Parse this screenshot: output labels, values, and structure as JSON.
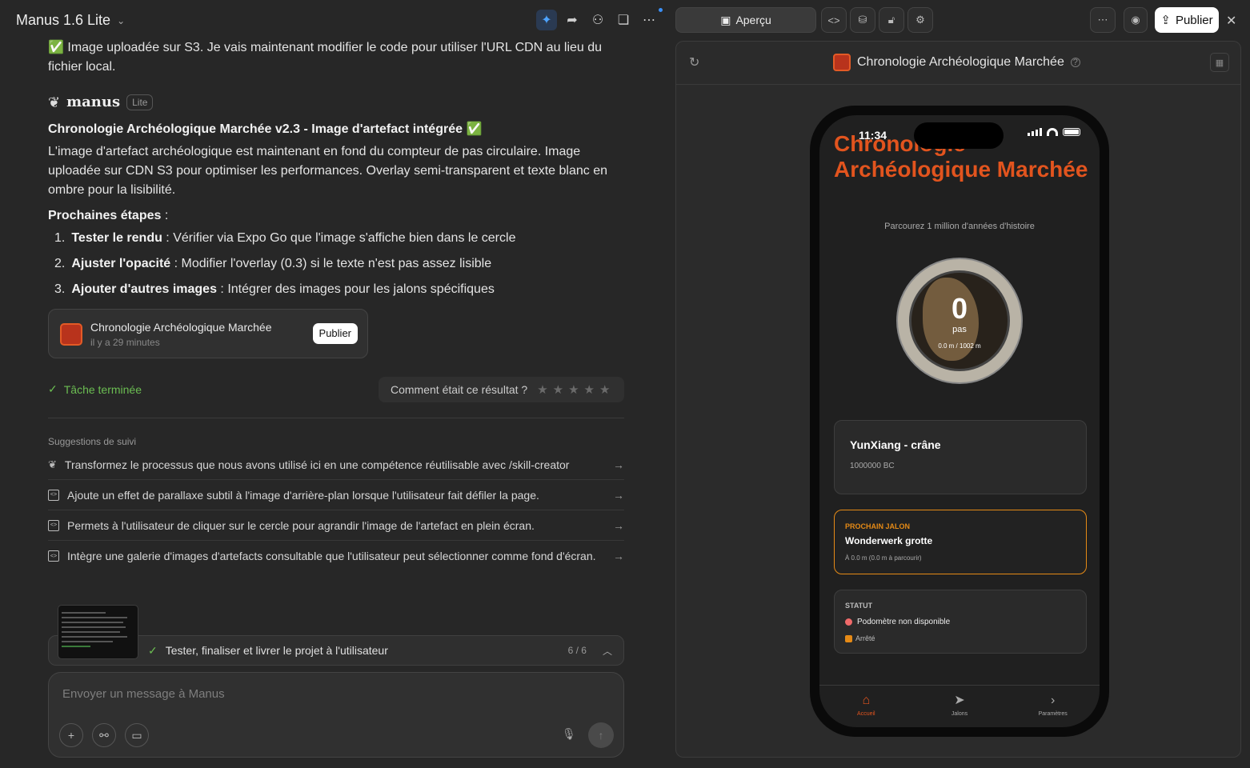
{
  "header": {
    "model": "Manus 1.6 Lite"
  },
  "chat": {
    "uploaded_msg": "✅ Image uploadée sur S3. Je vais maintenant modifier le code pour utiliser l'URL CDN au lieu du fichier local.",
    "brand": "manus",
    "brand_badge": "Lite",
    "heading": "Chronologie Archéologique Marchée v2.3 - Image d'artefact intégrée ✅",
    "body": "L'image d'artefact archéologique est maintenant en fond du compteur de pas circulaire. Image uploadée sur CDN S3 pour optimiser les performances. Overlay semi-transparent et texte blanc en ombre pour la lisibilité.",
    "next_label": "Prochaines étapes",
    "next_colon": " :",
    "steps": [
      {
        "num": "1.",
        "title": "Tester le rendu",
        "text": " : Vérifier via Expo Go que l'image s'affiche bien dans le cercle"
      },
      {
        "num": "2.",
        "title": "Ajuster l'opacité",
        "text": " : Modifier l'overlay (0.3) si le texte n'est pas assez lisible"
      },
      {
        "num": "3.",
        "title": "Ajouter d'autres images",
        "text": " : Intégrer des images pour les jalons spécifiques"
      }
    ],
    "card": {
      "title": "Chronologie Archéologique Marchée",
      "subtitle": "il y a 29 minutes",
      "button": "Publier"
    },
    "done": "Tâche terminée",
    "rate_question": "Comment était ce résultat ?",
    "suggest_heading": "Suggestions de suivi",
    "suggestions": [
      "Transformez le processus que nous avons utilisé ici en une compétence réutilisable avec /skill-creator",
      "Ajoute un effet de parallaxe subtil à l'image d'arrière-plan lorsque l'utilisateur fait défiler la page.",
      "Permets à l'utilisateur de cliquer sur le cercle pour agrandir l'image de l'artefact en plein écran.",
      "Intègre une galerie d'images d'artefacts consultable que l'utilisateur peut sélectionner comme fond d'écran."
    ],
    "task": {
      "label": "Tester, finaliser et livrer le projet à l'utilisateur",
      "count": "6 / 6"
    },
    "input": {
      "placeholder": "Envoyer un message à Manus"
    }
  },
  "preview": {
    "tab_label": "Aperçu",
    "publish": "Publier",
    "title": "Chronologie Archéologique Marchée"
  },
  "app": {
    "time": "11:34",
    "title": "Chronologie Archéologique Marchée",
    "subtitle": "Parcourez 1 million d'années d'histoire",
    "steps": "0",
    "steps_unit": "pas",
    "distance": "0.0 m / 1002 m",
    "milestone_name": "YunXiang - crâne",
    "milestone_year": "1000000 BC",
    "next_label": "PROCHAIN JALON",
    "next_name": "Wonderwerk grotte",
    "next_dist": "À 0.0 m (0.0 m à parcourir)",
    "status_label": "STATUT",
    "status_value": "Podomètre non disponible",
    "status_state": "Arrêté",
    "tabs": [
      "Accueil",
      "Jalons",
      "Paramètres"
    ]
  },
  "colors": {
    "accent": "#e2541e",
    "success": "#6bbd52",
    "warning": "#e58a16"
  }
}
